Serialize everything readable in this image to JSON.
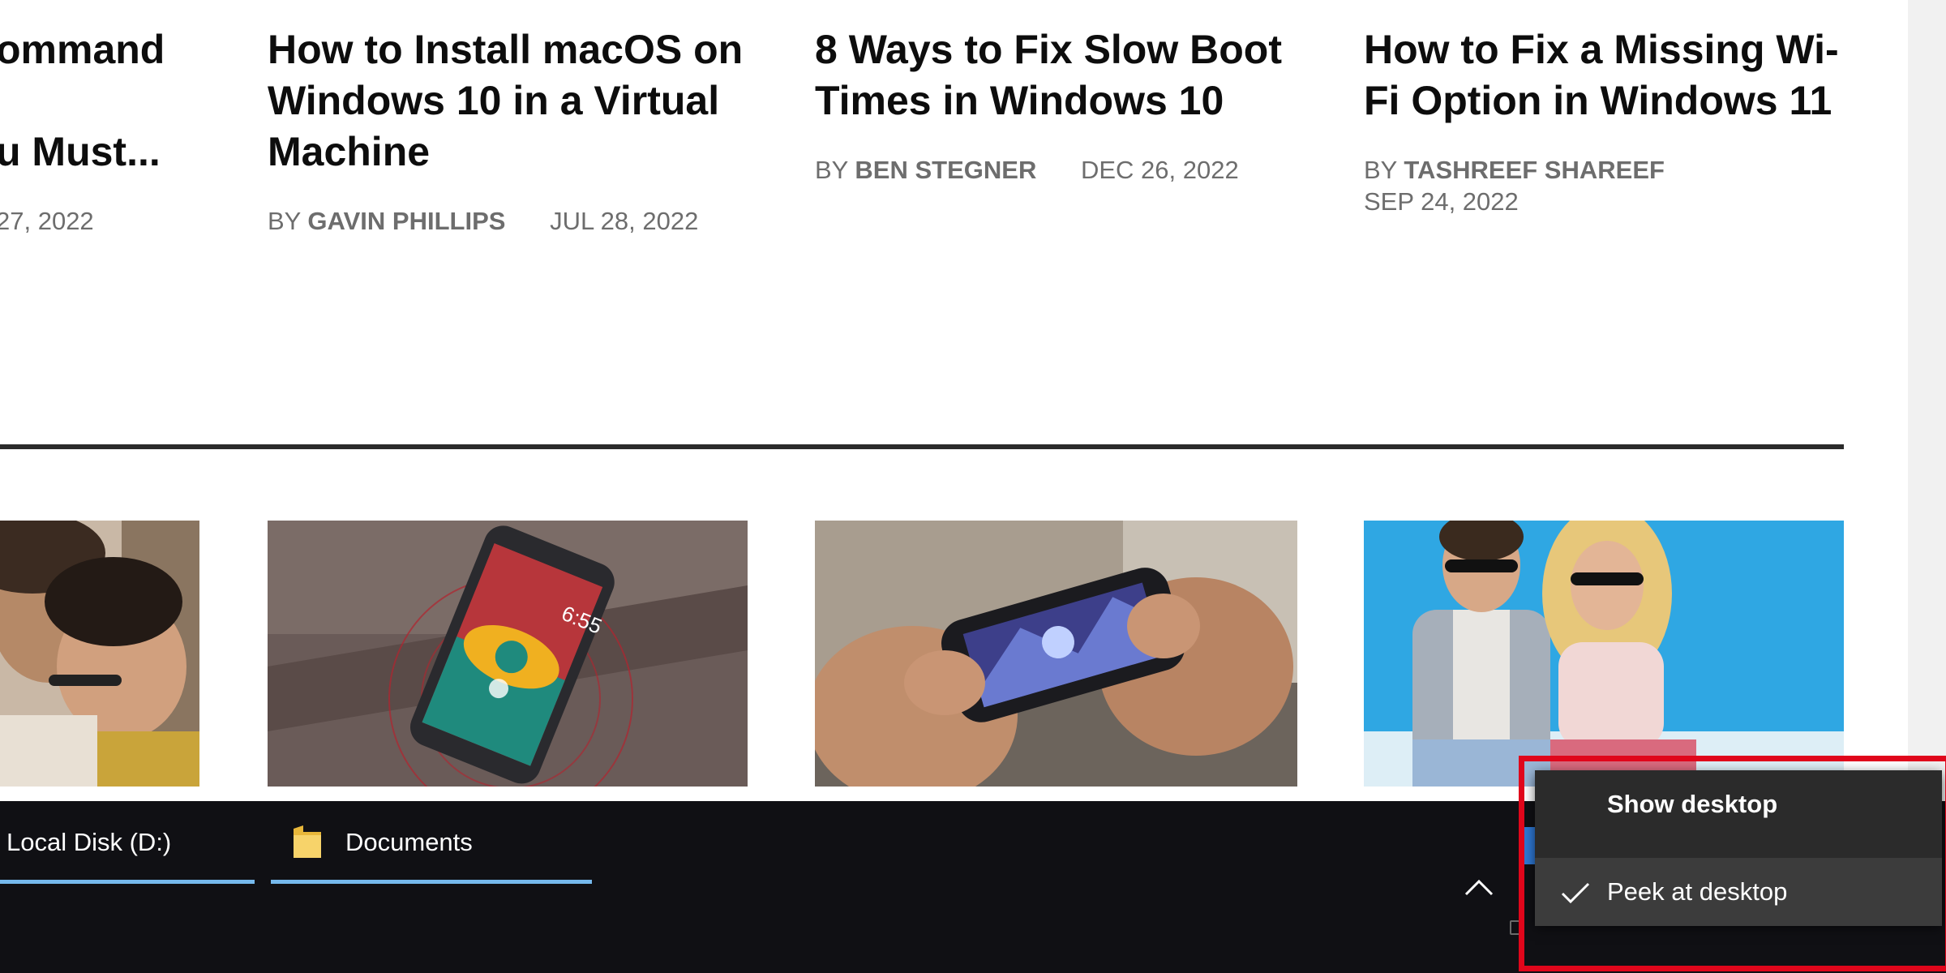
{
  "articles": [
    {
      "title_line1": "ommand",
      "title_line2": "",
      "title_line3": "u Must...",
      "by": "",
      "author": "",
      "date": "27, 2022"
    },
    {
      "title_line1": "How to Install macOS on",
      "title_line2": "Windows 10 in a Virtual",
      "title_line3": "Machine",
      "by": "BY",
      "author": "GAVIN PHILLIPS",
      "date": "JUL 28, 2022"
    },
    {
      "title_line1": "8 Ways to Fix Slow Boot",
      "title_line2": "Times in Windows 10",
      "title_line3": "",
      "by": "BY",
      "author": "BEN STEGNER",
      "date": "DEC 26, 2022"
    },
    {
      "title_line1": "How to Fix a Missing Wi-",
      "title_line2": "Fi Option in Windows 11",
      "title_line3": "",
      "by": "BY",
      "author": "TASHREEF SHAREEF",
      "date": "SEP 24, 2022"
    }
  ],
  "thumbnails": [
    {
      "icon": "people-photo"
    },
    {
      "icon": "smartphone-eye-photo",
      "clock": "6:55"
    },
    {
      "icon": "mobile-gaming-photo"
    },
    {
      "icon": "couple-photo"
    }
  ],
  "taskbar": {
    "buttons": [
      {
        "label": "Local Disk (D:)",
        "icon": "drive-icon"
      },
      {
        "label": "Documents",
        "icon": "folder-icon"
      }
    ],
    "tray_icon": "chevron-up-icon",
    "underline_color": "#76b9ed"
  },
  "context_menu": {
    "items": [
      {
        "label": "Show desktop",
        "checked": false
      },
      {
        "label": "Peek at desktop",
        "checked": true
      }
    ]
  },
  "colors": {
    "highlight": "#e0061b",
    "taskbar_bg": "#101014",
    "menu_bg": "#2b2b2b"
  }
}
